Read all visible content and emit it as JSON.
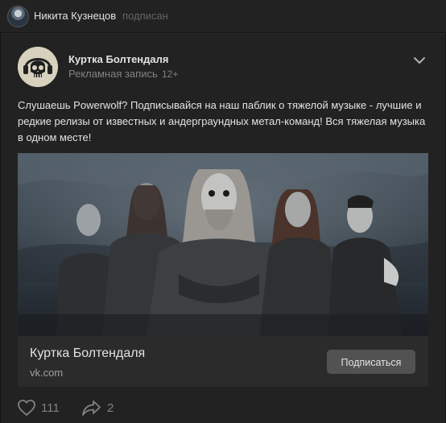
{
  "header": {
    "user_name": "Никита Кузнецов",
    "status": "подписан"
  },
  "post": {
    "group_name": "Куртка Болтендаля",
    "ad_label": "Рекламная запись",
    "age_rating": "12+",
    "text": "Слушаешь Powerwolf? Подписывайся на наш паблик о тяжелой музыке - лучшие и редкие релизы от известных и андерграундных метал-команд! Вся тяжелая музыка в одном месте!",
    "link": {
      "title": "Куртка Болтендаля",
      "domain": "vk.com",
      "button_label": "Подписаться"
    },
    "actions": {
      "likes": "111",
      "shares": "2"
    }
  },
  "icons": {
    "menu": "chevron-down-icon",
    "like": "heart-icon",
    "share": "share-arrow-icon"
  },
  "colors": {
    "background": "#141414",
    "card": "#222222",
    "text_primary": "#e1e3e6",
    "text_secondary": "#828282",
    "button": "#525252"
  }
}
